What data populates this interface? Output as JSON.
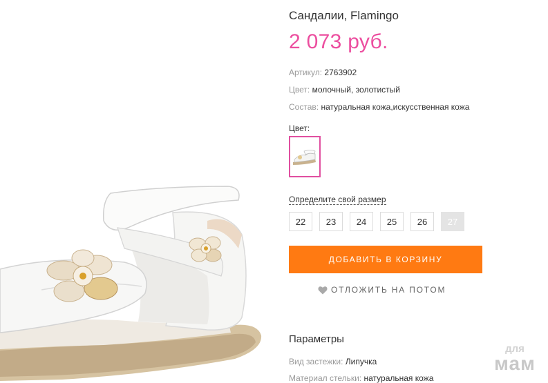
{
  "product": {
    "title": "Сандалии, Flamingo",
    "price": "2 073 руб.",
    "properties": [
      {
        "label": "Артикул:",
        "value": "2763902"
      },
      {
        "label": "Цвет:",
        "value": "молочный, золотистый"
      },
      {
        "label": "Состав:",
        "value": "натуральная кожа,искусственная кожа"
      }
    ]
  },
  "color_selector": {
    "label": "Цвет:",
    "swatch_icon": "sandal-thumbnail-icon",
    "selected": true
  },
  "size_selector": {
    "link_label": "Определите свой размер",
    "sizes": [
      {
        "label": "22",
        "available": true
      },
      {
        "label": "23",
        "available": true
      },
      {
        "label": "24",
        "available": true
      },
      {
        "label": "25",
        "available": true
      },
      {
        "label": "26",
        "available": true
      },
      {
        "label": "27",
        "available": false
      }
    ]
  },
  "actions": {
    "add_to_cart": "ДОБАВИТЬ В КОРЗИНУ",
    "wishlist": "ОТЛОЖИТЬ НА ПОТОМ",
    "wishlist_icon": "heart-icon"
  },
  "parameters": {
    "title": "Параметры",
    "items": [
      {
        "label": "Вид застежки:",
        "value": "Липучка"
      },
      {
        "label": "Материал стельки:",
        "value": "натуральная кожа"
      }
    ]
  },
  "watermark": {
    "line1": "для",
    "line2": "мам"
  },
  "colors": {
    "price": "#ec4e9f",
    "cart_button": "#ff7a12",
    "swatch_border": "#e04fa0",
    "unavailable_size": "#e4e4e4"
  }
}
